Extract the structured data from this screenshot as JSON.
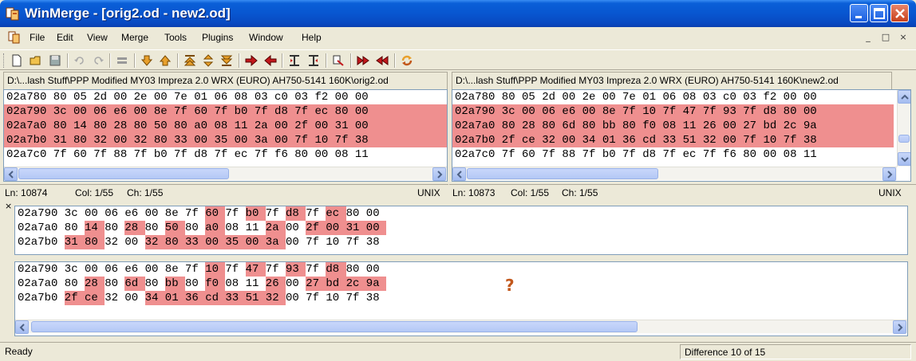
{
  "window": {
    "title": "WinMerge - [orig2.od - new2.od]"
  },
  "menu": [
    "File",
    "Edit",
    "View",
    "Merge",
    "Tools",
    "Plugins",
    "Window",
    "Help"
  ],
  "mdi_buttons": [
    "_",
    "□",
    "×"
  ],
  "left": {
    "path": "D:\\...lash Stuff\\PPP Modified MY03 Impreza 2.0 WRX (EURO) AH750-5141 160K\\orig2.od",
    "rows": [
      "02a780 80 05 2d 00 2e 00 7e 01 06 08 03 c0 03 f2 00 00",
      "02a790 3c 00 06 e6 00 8e 7f 60 7f b0 7f d8 7f ec 80 00",
      "02a7a0 80 14 80 28 80 50 80 a0 08 11 2a 00 2f 00 31 00",
      "02a7b0 31 80 32 00 32 80 33 00 35 00 3a 00 7f 10 7f 38",
      "02a7c0 7f 60 7f 88 7f b0 7f d8 7f ec 7f f6 80 00 08 11"
    ],
    "status": {
      "ln": "Ln: 10874",
      "col": "Col: 1/55",
      "ch": "Ch: 1/55",
      "eol": "UNIX"
    }
  },
  "right": {
    "path": "D:\\...lash Stuff\\PPP Modified MY03 Impreza 2.0 WRX (EURO) AH750-5141 160K\\new2.od",
    "rows": [
      "02a780 80 05 2d 00 2e 00 7e 01 06 08 03 c0 03 f2 00 00",
      "02a790 3c 00 06 e6 00 8e 7f 10 7f 47 7f 93 7f d8 80 00",
      "02a7a0 80 28 80 6d 80 bb 80 f0 08 11 26 00 27 bd 2c 9a",
      "02a7b0 2f ce 32 00 34 01 36 cd 33 51 32 00 7f 10 7f 38",
      "02a7c0 7f 60 7f 88 7f b0 7f d8 7f ec 7f f6 80 00 08 11"
    ],
    "status": {
      "ln": "Ln: 10873",
      "col": "Col: 1/55",
      "ch": "Ch: 1/55",
      "eol": "UNIX"
    }
  },
  "detail_close": "×",
  "detail_top": {
    "rows": [
      "02a790 3c 00 06 e6 00 8e 7f 60 7f b0 7f d8 7f ec 80 00",
      "02a7a0 80 14 80 28 80 50 80 a0 08 11 2a 00 2f 00 31 00",
      "02a7b0 31 80 32 00 32 80 33 00 35 00 3a 00 7f 10 7f 38"
    ]
  },
  "detail_bottom": {
    "rows": [
      "02a790 3c 00 06 e6 00 8e 7f 10 7f 47 7f 93 7f d8 80 00",
      "02a7a0 80 28 80 6d 80 bb 80 f0 08 11 26 00 27 bd 2c 9a",
      "02a7b0 2f ce 32 00 34 01 36 cd 33 51 32 00 7f 10 7f 38"
    ],
    "annotation": "?"
  },
  "statusbar": {
    "left": "Ready",
    "right": "Difference 10 of 15"
  },
  "colors": {
    "diff_line": "#ef8f8f",
    "diff_word": "#ef8f8f",
    "annotation": "#c2581c",
    "titlebar": "#0856d0"
  },
  "icons": {
    "app": "winmerge-icon",
    "toolbar": [
      "new-icon",
      "open-icon",
      "save-icon",
      "undo-icon",
      "redo-icon",
      "options-icon",
      "next-diff-icon",
      "prev-diff-icon",
      "first-diff-icon",
      "current-diff-icon",
      "last-diff-icon",
      "copy-right-icon",
      "copy-left-icon",
      "copy-right-advance-icon",
      "copy-left-advance-icon",
      "compare-icon",
      "all-right-icon",
      "all-left-icon",
      "refresh-icon"
    ]
  }
}
